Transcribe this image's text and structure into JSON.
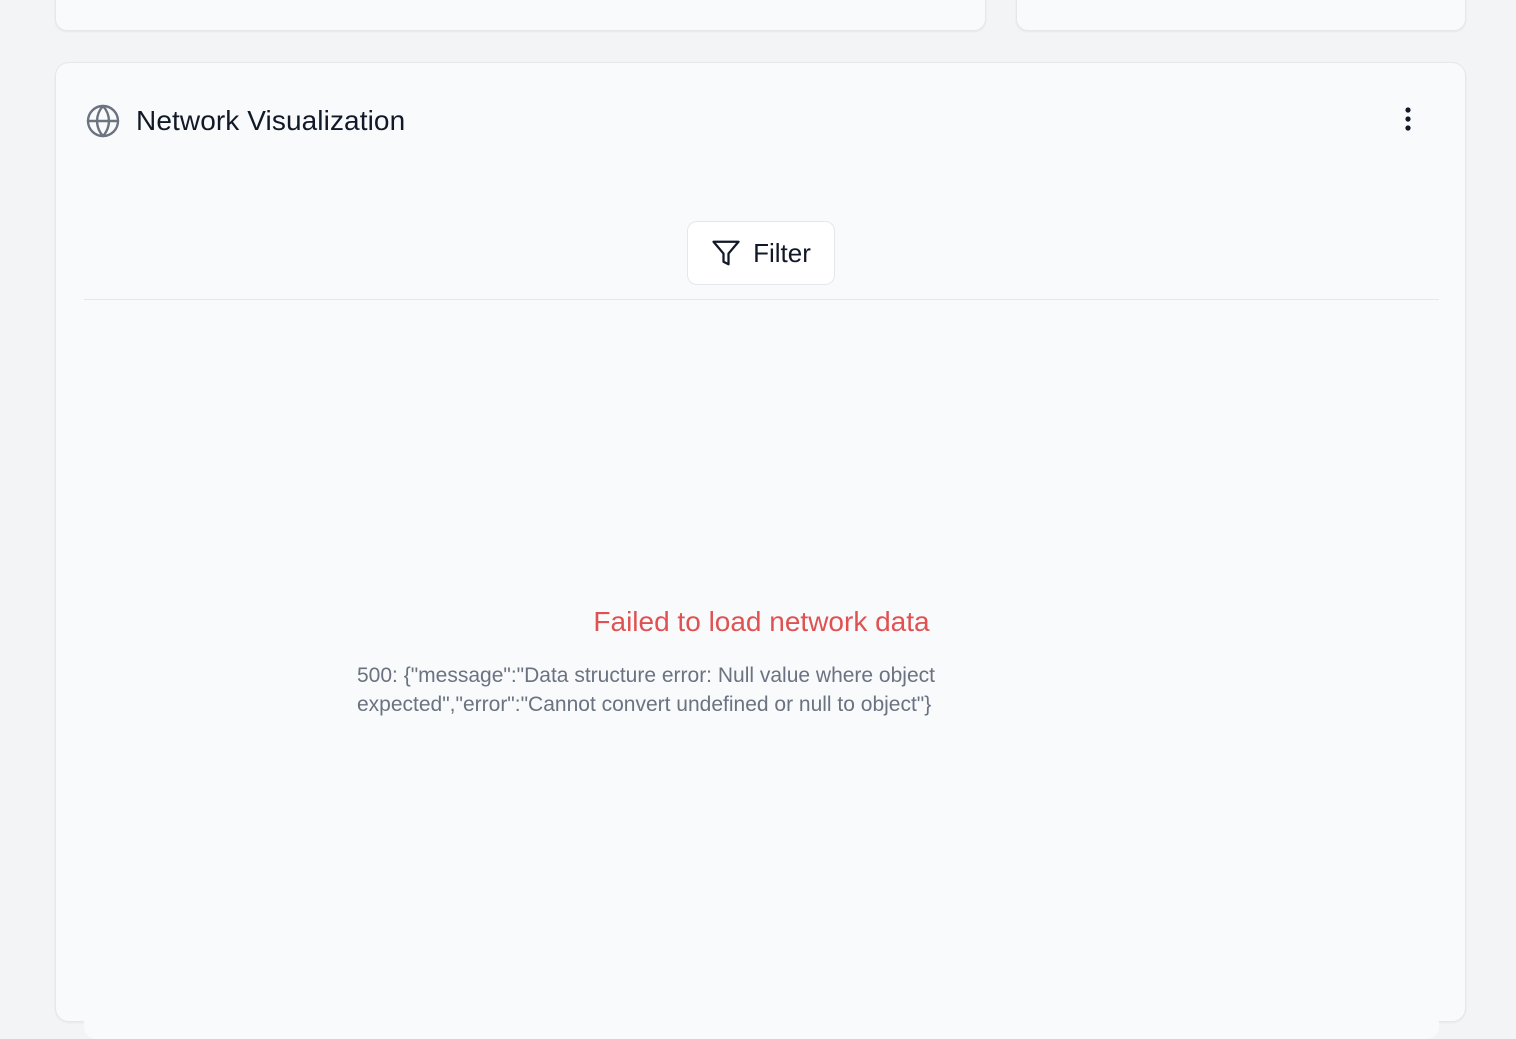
{
  "panel": {
    "title": "Network Visualization",
    "icon": "globe-icon",
    "menu_icon": "more-vertical-icon"
  },
  "toolbar": {
    "filter_label": "Filter",
    "filter_icon": "filter-icon"
  },
  "error": {
    "title": "Failed to load network data",
    "detail": "500: {\"message\":\"Data structure error: Null value where object expected\",\"error\":\"Cannot convert undefined or null to object\"}",
    "title_color": "#e05252"
  }
}
